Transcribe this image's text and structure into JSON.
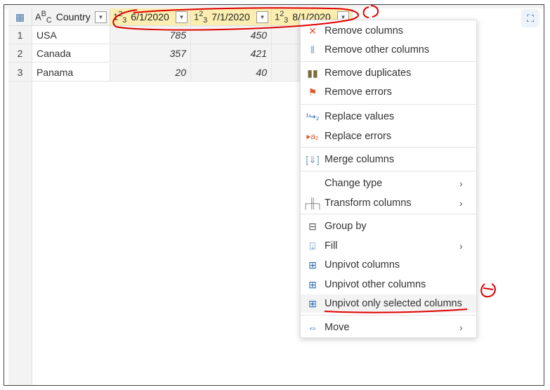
{
  "table": {
    "columns": [
      {
        "type": "ABC",
        "name": "Country"
      },
      {
        "type": "123",
        "name": "6/1/2020"
      },
      {
        "type": "123",
        "name": "7/1/2020"
      },
      {
        "type": "123",
        "name": "8/1/2020"
      }
    ],
    "rows": [
      {
        "n": "1",
        "country": "USA",
        "v1": "785",
        "v2": "450"
      },
      {
        "n": "2",
        "country": "Canada",
        "v1": "357",
        "v2": "421"
      },
      {
        "n": "3",
        "country": "Panama",
        "v1": "20",
        "v2": "40"
      }
    ]
  },
  "menu": {
    "items": [
      {
        "label": "Remove columns",
        "icon": "remove-columns-icon"
      },
      {
        "label": "Remove other columns",
        "icon": "remove-other-columns-icon"
      },
      {
        "label": "Remove duplicates",
        "icon": "remove-duplicates-icon"
      },
      {
        "label": "Remove errors",
        "icon": "remove-errors-icon"
      },
      {
        "label": "Replace values",
        "icon": "replace-values-icon"
      },
      {
        "label": "Replace errors",
        "icon": "replace-errors-icon"
      },
      {
        "label": "Merge columns",
        "icon": "merge-columns-icon"
      },
      {
        "label": "Change type",
        "icon": ""
      },
      {
        "label": "Transform columns",
        "icon": "transform-columns-icon"
      },
      {
        "label": "Group by",
        "icon": "group-by-icon"
      },
      {
        "label": "Fill",
        "icon": "fill-icon"
      },
      {
        "label": "Unpivot columns",
        "icon": "unpivot-icon"
      },
      {
        "label": "Unpivot other columns",
        "icon": "unpivot-icon"
      },
      {
        "label": "Unpivot only selected columns",
        "icon": "unpivot-icon"
      },
      {
        "label": "Move",
        "icon": "move-icon"
      }
    ]
  },
  "colors": {
    "selected_header": "#fbeeb0",
    "annotation": "#e00000"
  }
}
